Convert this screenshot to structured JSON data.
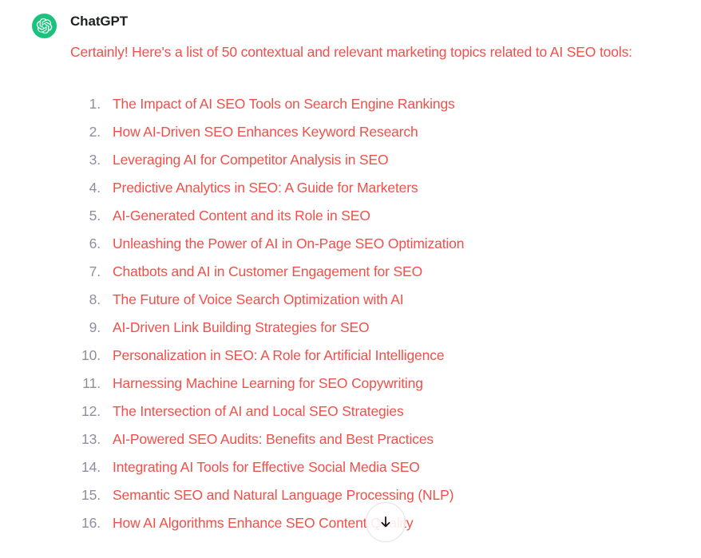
{
  "colors": {
    "accent_text": "#F0504A",
    "number_gray": "#8E8EA0",
    "author_dark": "#202123",
    "avatar_green": "#19C37D",
    "background": "#FFFFFF",
    "button_border": "#E3E3E6"
  },
  "message": {
    "author": "ChatGPT",
    "avatar_icon": "openai-logo-icon",
    "intro": "Certainly! Here's a list of 50 contextual and relevant marketing topics related to AI SEO tools:"
  },
  "list": {
    "items": [
      {
        "number": "1.",
        "text": "The Impact of AI SEO Tools on Search Engine Rankings"
      },
      {
        "number": "2.",
        "text": "How AI-Driven SEO Enhances Keyword Research"
      },
      {
        "number": "3.",
        "text": "Leveraging AI for Competitor Analysis in SEO"
      },
      {
        "number": "4.",
        "text": "Predictive Analytics in SEO: A Guide for Marketers"
      },
      {
        "number": "5.",
        "text": "AI-Generated Content and its Role in SEO"
      },
      {
        "number": "6.",
        "text": "Unleashing the Power of AI in On-Page SEO Optimization"
      },
      {
        "number": "7.",
        "text": "Chatbots and AI in Customer Engagement for SEO"
      },
      {
        "number": "8.",
        "text": "The Future of Voice Search Optimization with AI"
      },
      {
        "number": "9.",
        "text": "AI-Driven Link Building Strategies for SEO"
      },
      {
        "number": "10.",
        "text": "Personalization in SEO: A Role for Artificial Intelligence"
      },
      {
        "number": "11.",
        "text": "Harnessing Machine Learning for SEO Copywriting"
      },
      {
        "number": "12.",
        "text": "The Intersection of AI and Local SEO Strategies"
      },
      {
        "number": "13.",
        "text": "AI-Powered SEO Audits: Benefits and Best Practices"
      },
      {
        "number": "14.",
        "text": "Integrating AI Tools for Effective Social Media SEO"
      },
      {
        "number": "15.",
        "text": "Semantic SEO and Natural Language Processing (NLP)"
      },
      {
        "number": "16.",
        "text": "How AI Algorithms Enhance SEO Content Quality"
      }
    ]
  },
  "scroll_button": {
    "icon": "arrow-down-icon",
    "label": "Scroll to bottom"
  }
}
